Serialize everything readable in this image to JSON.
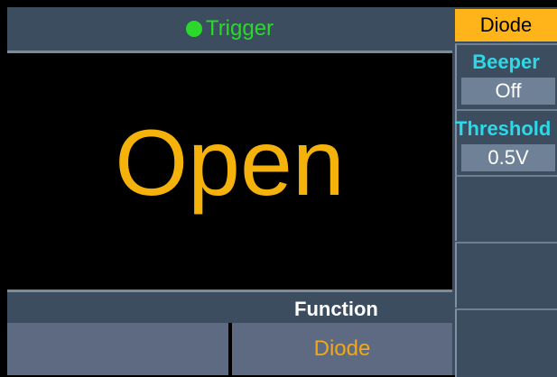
{
  "header": {
    "trigger_label": "Trigger"
  },
  "display": {
    "reading": "Open"
  },
  "function_bar": {
    "label": "Function",
    "options": [
      "",
      "Diode"
    ]
  },
  "side_menu": {
    "mode_tab": "Diode",
    "beeper_label": "Beeper",
    "beeper_value": "Off",
    "threshold_label": "Threshold",
    "threshold_value": "0.5V"
  },
  "colors": {
    "accent": "#ffb419",
    "trigger_green": "#2bd82b",
    "label_cyan": "#2cd9e8",
    "panel": "#3b4d5f",
    "reading": "#f5b20a"
  }
}
